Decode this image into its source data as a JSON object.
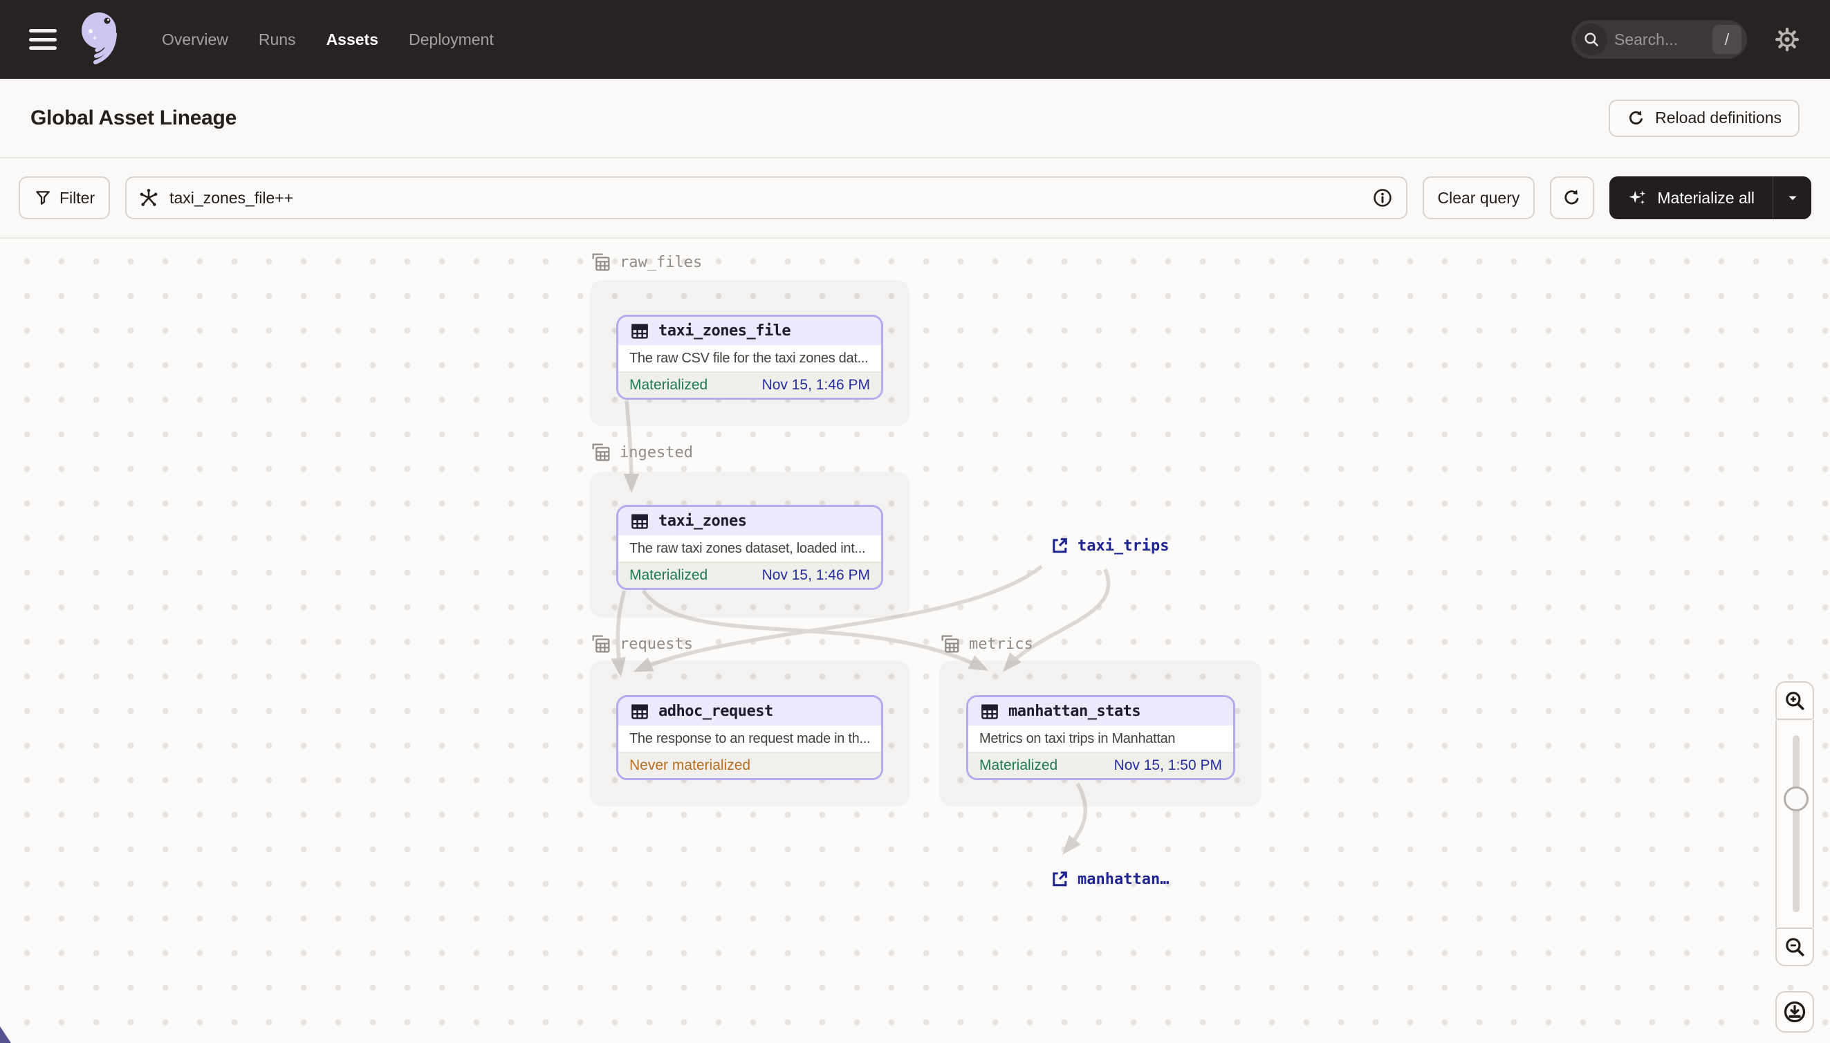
{
  "header": {
    "nav_items": [
      {
        "label": "Overview",
        "active": false
      },
      {
        "label": "Runs",
        "active": false
      },
      {
        "label": "Assets",
        "active": true
      },
      {
        "label": "Deployment",
        "active": false
      }
    ],
    "search_placeholder": "Search...",
    "search_shortcut": "/"
  },
  "page_header": {
    "title": "Global Asset Lineage",
    "reload_button": "Reload definitions"
  },
  "toolbar": {
    "filter_button": "Filter",
    "query_value": "taxi_zones_file++",
    "clear_query_button": "Clear query",
    "materialize_button": "Materialize all"
  },
  "graph": {
    "groups": [
      {
        "name": "raw_files"
      },
      {
        "name": "ingested"
      },
      {
        "name": "requests"
      },
      {
        "name": "metrics"
      }
    ],
    "assets": [
      {
        "name": "taxi_zones_file",
        "description": "The raw CSV file for the taxi zones dat...",
        "status": "Materialized",
        "timestamp": "Nov 15, 1:46 PM"
      },
      {
        "name": "taxi_zones",
        "description": "The raw taxi zones dataset, loaded int...",
        "status": "Materialized",
        "timestamp": "Nov 15, 1:46 PM"
      },
      {
        "name": "adhoc_request",
        "description": "The response to an request made in th...",
        "status": "Never materialized",
        "timestamp": ""
      },
      {
        "name": "manhattan_stats",
        "description": "Metrics on taxi trips in Manhattan",
        "status": "Materialized",
        "timestamp": "Nov 15, 1:50 PM"
      }
    ],
    "external_assets": [
      {
        "name": "taxi_trips"
      },
      {
        "name": "manhattan…"
      }
    ]
  },
  "colors": {
    "node_border": "#b3abec",
    "status_green": "#1e7b4c",
    "status_orange": "#b86c1e",
    "timestamp_navy": "#272da4",
    "external_navy": "#1f2590"
  }
}
